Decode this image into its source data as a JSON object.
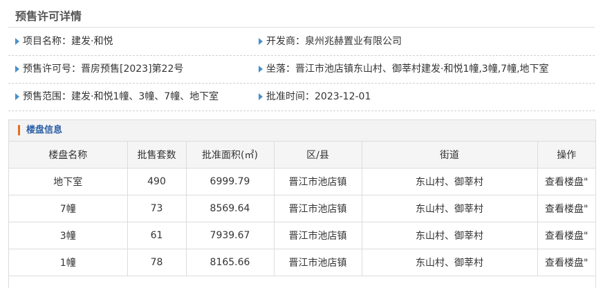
{
  "page": {
    "title": "预售许可详情"
  },
  "info": {
    "project_name": "项目名称：建发·和悦",
    "developer": "开发商：泉州兆赫置业有限公司",
    "permit_no": "预售许可号：晋房预售[2023]第22号",
    "location": "坐落：晋江市池店镇东山村、御莘村建发·和悦1幢,3幢,7幢,地下室",
    "scope": "预售范围：建发·和悦1幢、3幢、7幢、地下室",
    "approval_time": "批准时间：2023-12-01"
  },
  "buildings": {
    "section_title": "楼盘信息",
    "columns": [
      "楼盘名称",
      "批售套数",
      "批准面积(㎡)",
      "区/县",
      "街道",
      "操作"
    ],
    "rows": [
      {
        "name": "地下室",
        "units": "490",
        "area": "6999.79",
        "district": "晋江市池店镇",
        "street": "东山村、御莘村",
        "action": "查看楼盘\""
      },
      {
        "name": "7幢",
        "units": "73",
        "area": "8569.64",
        "district": "晋江市池店镇",
        "street": "东山村、御莘村",
        "action": "查看楼盘\""
      },
      {
        "name": "3幢",
        "units": "61",
        "area": "7939.67",
        "district": "晋江市池店镇",
        "street": "东山村、御莘村",
        "action": "查看楼盘\""
      },
      {
        "name": "1幢",
        "units": "78",
        "area": "8165.66",
        "district": "晋江市池店镇",
        "street": "东山村、御莘村",
        "action": "查看楼盘\""
      }
    ]
  },
  "colors": {
    "accent_bar": "#e07020",
    "section_title": "#2a5ea5",
    "bullet": "#4a90c8"
  },
  "icons": {
    "bullet": "triangle-right-icon"
  }
}
